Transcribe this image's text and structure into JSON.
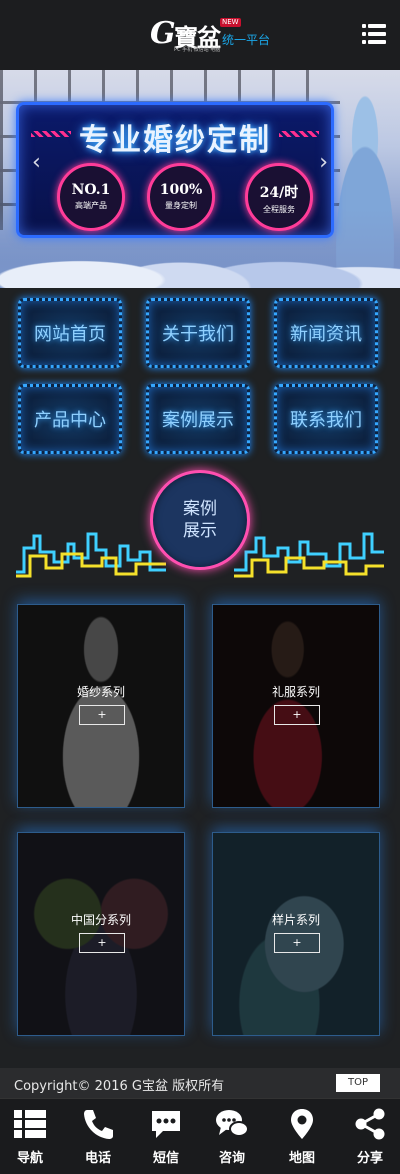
{
  "header": {
    "logo_g": "G",
    "logo_text": "寶盆",
    "logo_badge": "NEW",
    "logo_tagline": "统一平台",
    "logo_sub": "PC 手机 微信站 电脑"
  },
  "banner": {
    "title": "专业婚纱定制",
    "badges": [
      {
        "big": "NO.1",
        "small": "高端产品"
      },
      {
        "big": "100%",
        "small": "量身定制"
      },
      {
        "big": "24/时",
        "small": "全程服务"
      }
    ],
    "prev": "‹",
    "next": "›"
  },
  "nav": [
    {
      "label": "网站首页"
    },
    {
      "label": "关于我们"
    },
    {
      "label": "新闻资讯"
    },
    {
      "label": "产品中心"
    },
    {
      "label": "案例展示"
    },
    {
      "label": "联系我们"
    }
  ],
  "cases": {
    "title_line1": "案例",
    "title_line2": "展示",
    "items": [
      {
        "label": "婚纱系列",
        "plus": "+"
      },
      {
        "label": "礼服系列",
        "plus": "+"
      },
      {
        "label": "中国分系列",
        "plus": "+"
      },
      {
        "label": "样片系列",
        "plus": "+"
      }
    ]
  },
  "footer": {
    "copyright": "Copyright© 2016  G宝盆 版权所有",
    "top": "TOP"
  },
  "tabbar": [
    {
      "label": "导航",
      "icon": "grid-list-icon"
    },
    {
      "label": "电话",
      "icon": "phone-icon"
    },
    {
      "label": "短信",
      "icon": "sms-icon"
    },
    {
      "label": "咨询",
      "icon": "chat-icon"
    },
    {
      "label": "地图",
      "icon": "map-pin-icon"
    },
    {
      "label": "分享",
      "icon": "share-icon"
    }
  ],
  "colors": {
    "accent_blue": "#35a7ff",
    "accent_pink": "#ff4fb0",
    "background": "#1f2123"
  }
}
